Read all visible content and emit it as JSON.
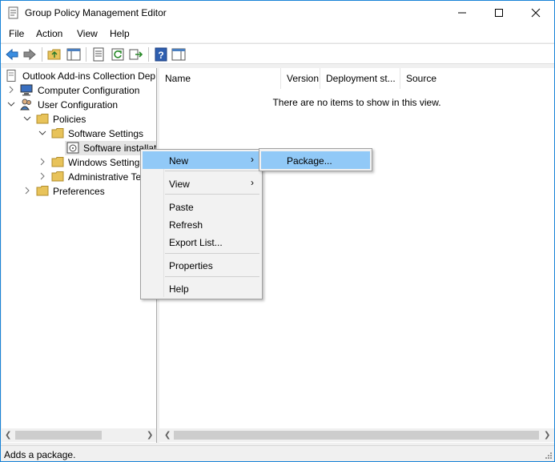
{
  "window": {
    "title": "Group Policy Management Editor"
  },
  "menubar": {
    "items": [
      "File",
      "Action",
      "View",
      "Help"
    ]
  },
  "toolbar": {
    "buttons": [
      "back-icon",
      "forward-icon",
      "up-folder-icon",
      "show-hide-tree-icon",
      "properties-icon",
      "refresh-icon",
      "export-list-icon",
      "help-icon",
      "show-hide-action-pane-icon"
    ]
  },
  "tree": {
    "root": "Outlook Add-ins Collection Dep",
    "computer_config": "Computer Configuration",
    "user_config": "User Configuration",
    "policies": "Policies",
    "software_settings": "Software Settings",
    "software_installation": "Software installat",
    "windows_settings": "Windows Settings",
    "admin_templates": "Administrative Te",
    "preferences": "Preferences"
  },
  "list": {
    "columns": [
      "Name",
      "Version",
      "Deployment st...",
      "Source"
    ],
    "empty_message": "There are no items to show in this view."
  },
  "context_menu": {
    "new": "New",
    "view": "View",
    "paste": "Paste",
    "refresh": "Refresh",
    "export_list": "Export List...",
    "properties": "Properties",
    "help": "Help",
    "submenu_arrow": "›"
  },
  "submenu": {
    "package": "Package..."
  },
  "status": {
    "text": "Adds a package."
  },
  "colors": {
    "highlight": "#91c9f7",
    "window_border": "#1883d7",
    "folder": "#e8c35a"
  }
}
